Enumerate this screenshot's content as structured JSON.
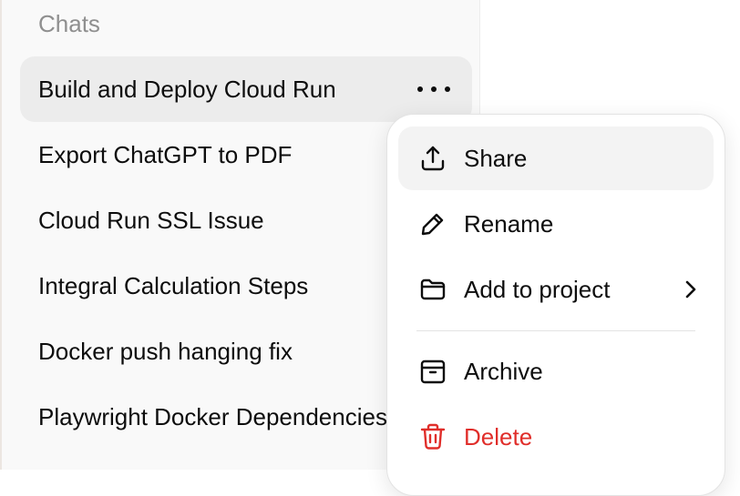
{
  "sidebar": {
    "section_label": "Chats",
    "items": [
      {
        "label": "Build and Deploy Cloud Run"
      },
      {
        "label": "Export ChatGPT to PDF"
      },
      {
        "label": "Cloud Run SSL Issue"
      },
      {
        "label": "Integral Calculation Steps"
      },
      {
        "label": "Docker push hanging fix"
      },
      {
        "label": "Playwright Docker Dependencies"
      }
    ],
    "more_icon": "more-horizontal-icon"
  },
  "context_menu": {
    "items": [
      {
        "label": "Share",
        "icon": "share-icon"
      },
      {
        "label": "Rename",
        "icon": "pencil-icon"
      },
      {
        "label": "Add to project",
        "icon": "folder-icon",
        "submenu_icon": "chevron-right-icon"
      },
      {
        "label": "Archive",
        "icon": "archive-icon"
      },
      {
        "label": "Delete",
        "icon": "trash-icon"
      }
    ],
    "colors": {
      "danger": "#e02e2a",
      "hover": "#f3f3f3"
    }
  }
}
